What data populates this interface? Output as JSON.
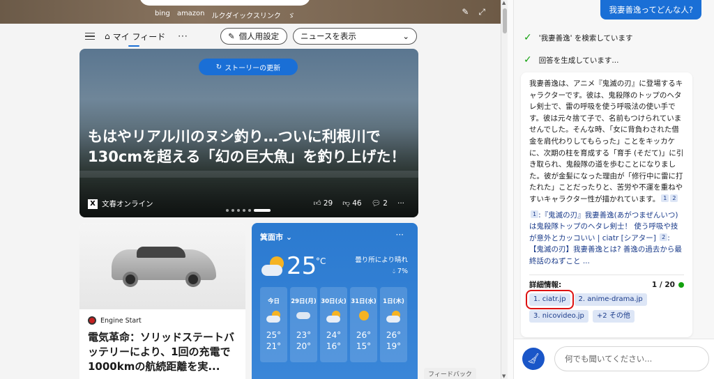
{
  "hero": {
    "quick_links": [
      "bing",
      "amazon",
      "ルクダイックスリンク",
      "ゞ"
    ]
  },
  "feed_bar": {
    "my_feed": "マイ フィード",
    "more": "···",
    "personalize": "個人用設定",
    "news_toggle": "ニュースを表示"
  },
  "top_story": {
    "refresh": "ストーリーの更新",
    "headline": "もはやリアル川のヌシ釣り…ついに利根川で130cmを超える「幻の巨大魚」を釣り上げた！",
    "source": "文春オンライン",
    "likes": "29",
    "dislikes": "46",
    "comments": "2",
    "more": "···"
  },
  "car_story": {
    "source": "Engine Start",
    "title": "電気革命：ソリッドステートバッテリーにより、1回の充電で1000kmの航続距離を実..."
  },
  "weather": {
    "city": "箕面市",
    "temp": "25",
    "unit": "°C",
    "condition": "曇り所により晴れ",
    "precip": "7%",
    "more": "···",
    "forecast": [
      {
        "label": "今日",
        "hi": "25°",
        "lo": "21°",
        "icon": "partly-cloudy-icon"
      },
      {
        "label": "29日(月)",
        "hi": "23°",
        "lo": "20°",
        "icon": "rain-icon"
      },
      {
        "label": "30日(火)",
        "hi": "24°",
        "lo": "16°",
        "icon": "rain-icon"
      },
      {
        "label": "31日(水)",
        "hi": "26°",
        "lo": "15°",
        "icon": "sunny-icon"
      },
      {
        "label": "1日(木)",
        "hi": "26°",
        "lo": "19°",
        "icon": "partly-cloudy-icon"
      }
    ]
  },
  "feedback": "フィードバック",
  "chat": {
    "user_message": "我妻善逸ってどんな人?",
    "status_search": "'我妻善逸' を検索しています",
    "status_generating": "回答を生成しています...",
    "answer": "我妻善逸は、アニメ『鬼滅の刃』に登場するキャラクターです。彼は、鬼殺隊のトップのヘタレ剣士で、雷の呼吸を使う呼吸法の使い手です。彼は元々捨て子で、名前もつけられていませんでした。そんな時、「女に背負わされた借金を肩代わりしてもらった」ことをキッカケに、次期の柱を育成する「育手 (そだて)」に引き取られ、鬼殺隊の道を歩むことになりました。彼が金髪になった理由が「修行中に雷に打たれた」ことだったりと、苦労や不運を重ねやすいキャラクター性が描かれています。",
    "refs": ":『鬼滅の刃』我妻善逸(あがつまぜんいつ)は鬼殺隊トップのヘタレ剣士！ 使う呼吸や技が意外とカッコいい | ciatr [シアター]",
    "refs2": ":【鬼滅の刃】我妻善逸とは? 善逸の過去から最終話のねずこと ...",
    "details_label": "詳細情報:",
    "count": "1 / 20",
    "chips": [
      "1. ciatr.jp",
      "2. anime-drama.jp",
      "3. nicovideo.jp",
      "+2 その他"
    ],
    "input_placeholder": "何でも聞いてください..."
  }
}
